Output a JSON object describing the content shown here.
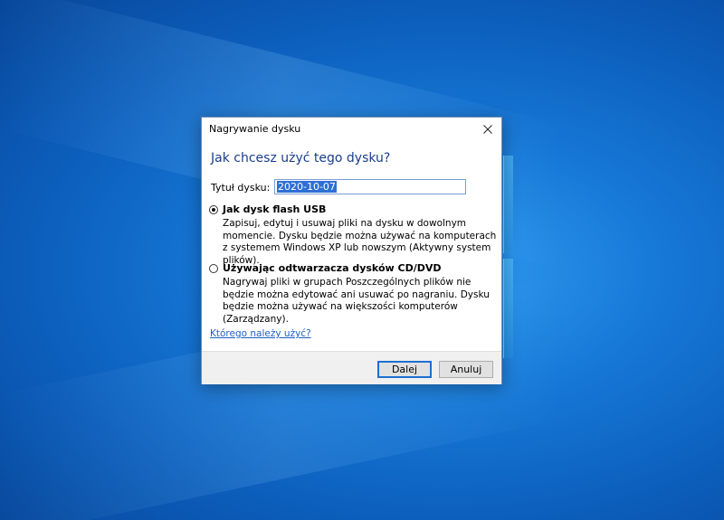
{
  "window": {
    "title": "Nagrywanie dysku"
  },
  "dialog": {
    "heading": "Jak chcesz użyć tego dysku?",
    "disc_title_label": "Tytuł dysku:",
    "disc_title_value": "2020-10-07",
    "options": [
      {
        "label": "Jak dysk flash USB",
        "description": "Zapisuj, edytuj i usuwaj pliki na dysku w dowolnym momencie. Dysku będzie można używać na komputerach z systemem Windows XP lub nowszym (Aktywny system plików).",
        "selected": true
      },
      {
        "label": "Używając odtwarzacza dysków CD/DVD",
        "description": "Nagrywaj pliki w grupach Poszczególnych plików nie będzie można edytować ani usuwać po nagraniu. Dysku będzie można używać na większości komputerów (Zarządzany).",
        "selected": false
      }
    ],
    "help_link": "Którego należy użyć?",
    "next_label": "Dalej",
    "cancel_label": "Anuluj"
  },
  "colors": {
    "heading": "#1a3e8c",
    "link": "#1c5fc7",
    "selection": "#2f6fd6",
    "default_button_border": "#1f6fd0"
  },
  "icons": {
    "close": "close-icon"
  }
}
